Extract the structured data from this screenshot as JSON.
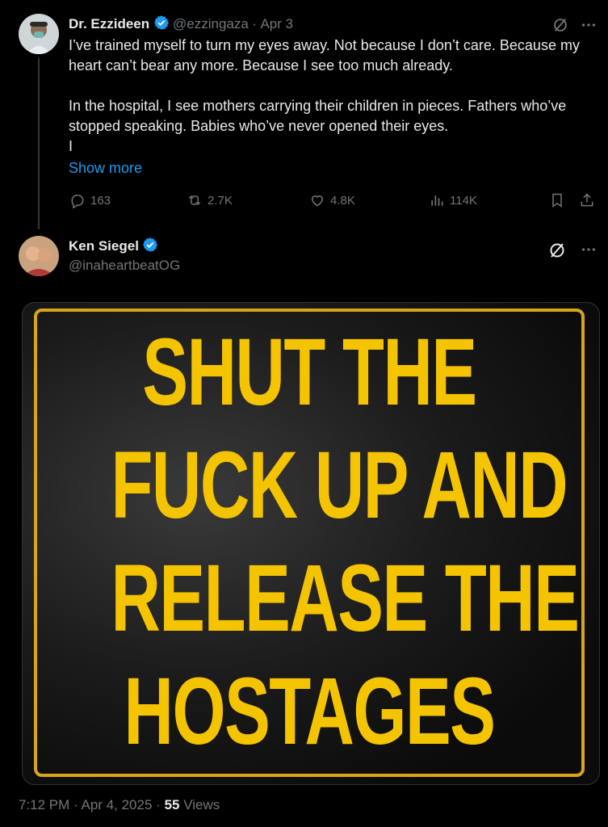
{
  "tweet1": {
    "display_name": "Dr. Ezzideen",
    "handle": "@ezzingaza",
    "separator": "·",
    "date": "Apr 3",
    "text": "I’ve trained myself to turn my eyes away. Not because I don’t care. Because my heart can’t bear any more. Because I see too much already.\n\nIn the hospital, I see mothers carrying their children in pieces. Fathers who’ve stopped speaking. Babies who’ve never opened their eyes.\nI",
    "show_more": "Show more",
    "replies": "163",
    "reposts": "2.7K",
    "likes": "4.8K",
    "views": "114K"
  },
  "tweet2": {
    "display_name": "Ken Siegel",
    "handle": "@inaheartbeatOG",
    "image_text_lines": [
      "SHUT THE",
      "FUCK UP AND",
      "RELEASE THE",
      "HOSTAGES"
    ],
    "footer": {
      "time": "7:12 PM",
      "separator1": "·",
      "date": "Apr 4, 2025",
      "separator2": "·",
      "view_count": "55",
      "views_label": "Views"
    }
  },
  "colors": {
    "background": "#000000",
    "text_primary": "#e7e9ea",
    "text_muted": "#71767b",
    "link": "#1d9bf0",
    "verified": "#1d9bf0",
    "sign_yellow": "#f5c400"
  },
  "icons": [
    "verified-badge-icon",
    "grok-icon",
    "more-icon",
    "reply-icon",
    "repost-icon",
    "like-icon",
    "views-icon",
    "bookmark-icon",
    "share-icon"
  ]
}
